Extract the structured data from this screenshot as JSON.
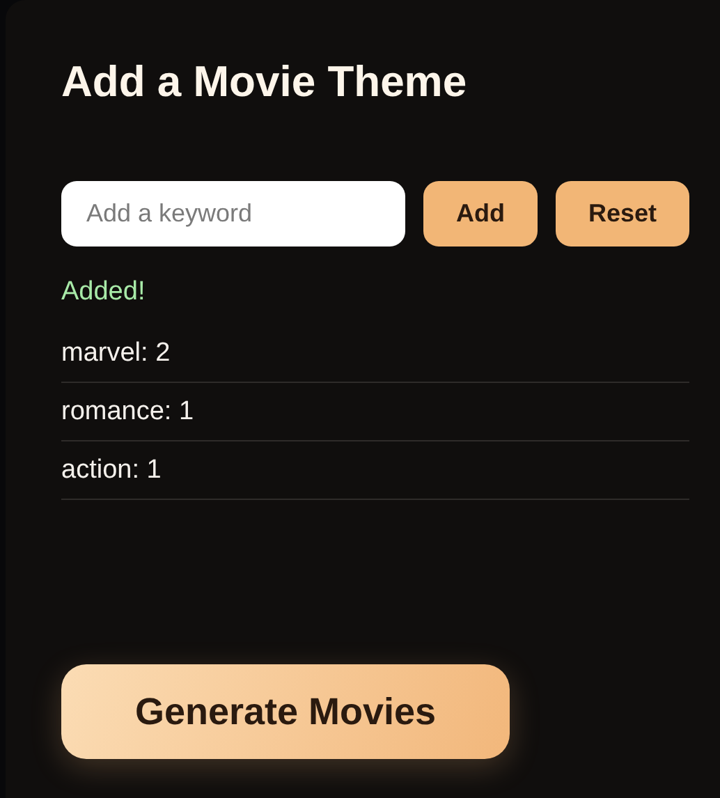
{
  "title": "Add a Movie Theme",
  "keyword_field": {
    "placeholder": "Add a keyword"
  },
  "buttons": [
    "Add",
    "Reset"
  ],
  "status": "Added!",
  "keywords": [
    {
      "text": "marvel: 2"
    },
    {
      "text": "romance: 1"
    },
    {
      "text": "action: 1"
    }
  ],
  "generate_button": "Generate Movies"
}
